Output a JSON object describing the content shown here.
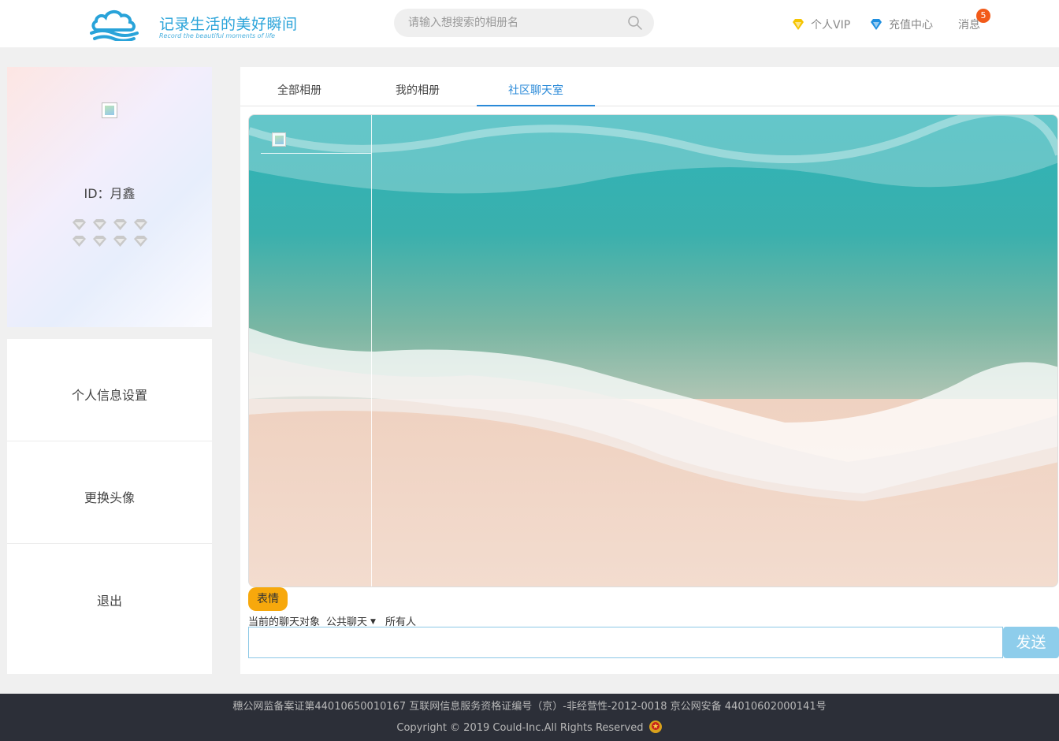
{
  "header": {
    "logo_title": "记录生活的美好瞬间",
    "logo_subtitle": "Record the beautiful moments of life",
    "search_placeholder": "请输入想搜索的相册名",
    "nav": {
      "vip_label": "个人VIP",
      "recharge_label": "充值中心",
      "messages_label": "消息",
      "messages_count": "5"
    },
    "colors": {
      "brand": "#29a3d9",
      "vip_gem": "#f5c400",
      "recharge_gem": "#1f8fe0",
      "badge": "#f25a19"
    }
  },
  "profile": {
    "id_text": "ID：月鑫",
    "level_icons": [
      "diamond-icon",
      "diamond-icon",
      "diamond-icon",
      "diamond-icon",
      "diamond-icon",
      "diamond-icon",
      "diamond-icon",
      "diamond-icon"
    ]
  },
  "menu": {
    "items": [
      {
        "label": "个人信息设置"
      },
      {
        "label": "更换头像"
      },
      {
        "label": "退出"
      }
    ]
  },
  "tabs": {
    "items": [
      {
        "label": "全部相册",
        "active": false
      },
      {
        "label": "我的相册",
        "active": false
      },
      {
        "label": "社区聊天室",
        "active": true
      }
    ],
    "active_color": "#2a8ad8"
  },
  "chat": {
    "emoji_label": "表情",
    "target_label": "当前的聊天对象",
    "channel_value": "公共聊天",
    "recipient_value": "所有人",
    "input_value": "",
    "send_label": "发送",
    "colors": {
      "emoji_button": "#f7a80c",
      "send_button": "#8ecdeb"
    }
  },
  "footer": {
    "line1": "穗公网监备案证第44010650010167   互联网信息服务资格证编号（京）-非经营性-2012-0018   京公网安备 44010602000141号",
    "line2": "Copyright   ©   2019 Could-Inc.All Rights Reserved"
  }
}
